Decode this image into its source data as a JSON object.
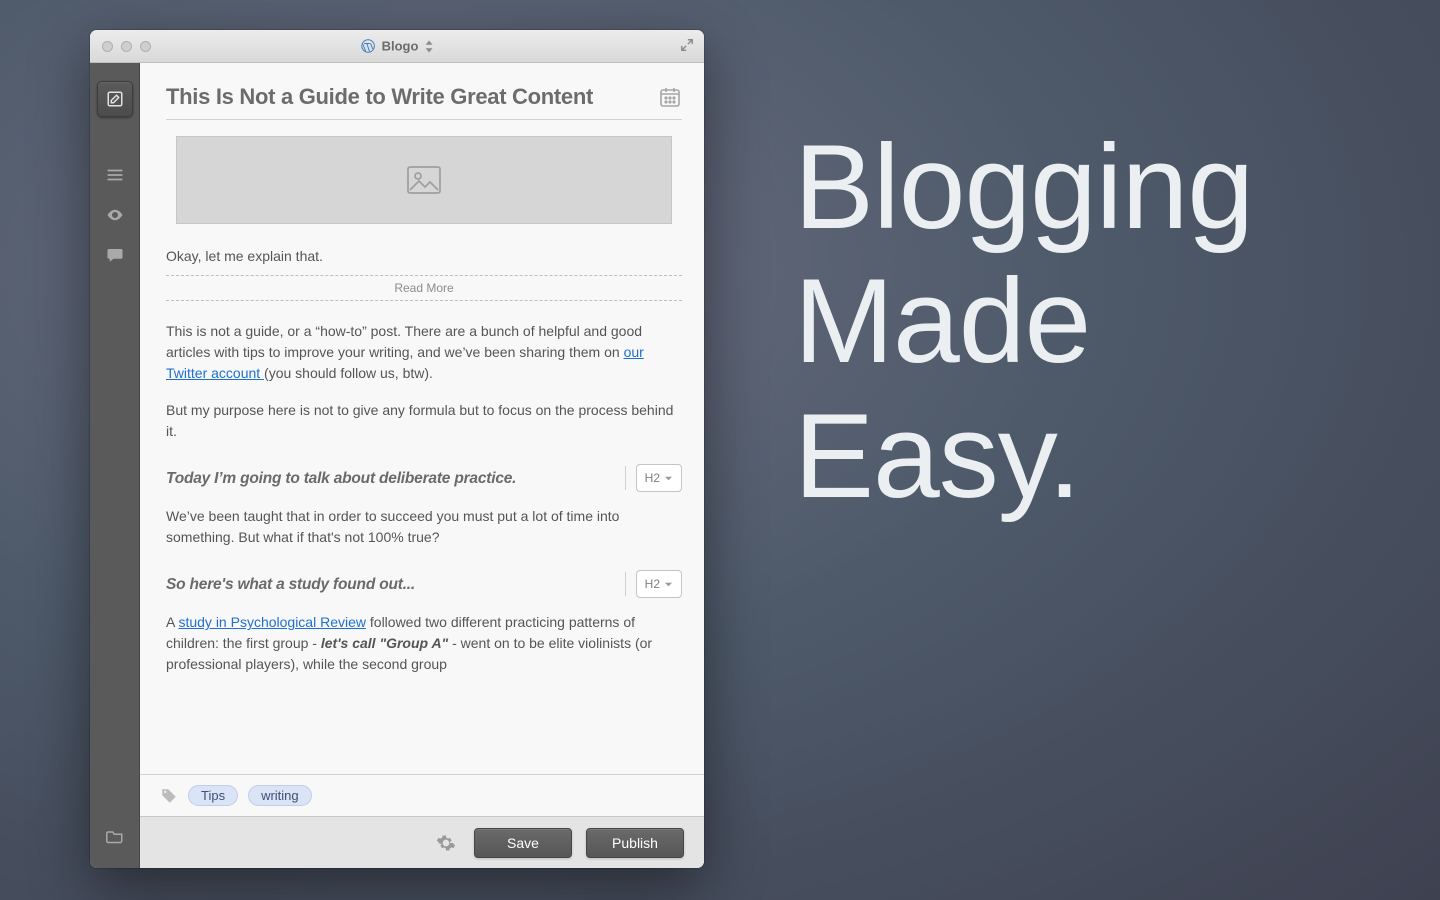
{
  "window": {
    "title": "Blogo"
  },
  "sidebar": {
    "items": [
      "compose",
      "list",
      "preview",
      "comments"
    ],
    "bottom": "folder"
  },
  "post": {
    "title": "This Is Not a Guide to Write Great Content",
    "intro": "Okay, let me explain that.",
    "read_more": "Read More",
    "para1_a": "This is not a guide, or a “how-to” post. There are a bunch of helpful and good articles with tips to improve your writing, and we’ve been sharing them on ",
    "para1_link": "our Twitter account ",
    "para1_b": "(you should follow us, btw).",
    "para2": "But my purpose here is not to give any formula but to focus on the process behind it.",
    "h1": "Today I’m going to talk about deliberate practice.",
    "h1_level": "H2",
    "para3": "We’ve been taught that in order to succeed you must put a lot of time into something. But what if that's not 100% true?",
    "h2": "So here's what a study found out...",
    "h2_level": "H2",
    "para4_a": "A ",
    "para4_link": "study in Psychological Review",
    "para4_b": " followed two different practicing patterns of children: the first group - ",
    "para4_bold": "let's call \"Group A\"",
    "para4_c": " - went on to be elite violinists (or professional players), while the second group"
  },
  "tags": [
    "Tips",
    "writing"
  ],
  "footer": {
    "save": "Save",
    "publish": "Publish"
  },
  "marketing": {
    "line1": "Blogging",
    "line2": "Made",
    "line3": "Easy."
  }
}
